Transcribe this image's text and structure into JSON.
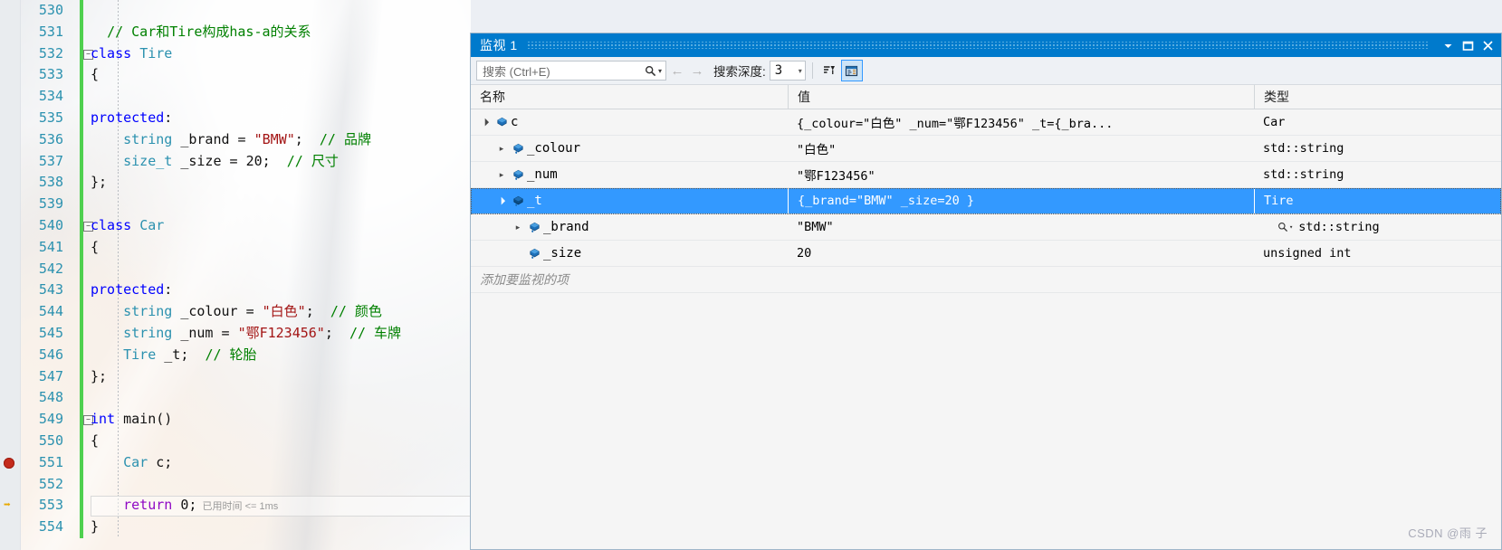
{
  "editor": {
    "lines": [
      {
        "num": "530",
        "tokens": [],
        "fold": false,
        "marker": ""
      },
      {
        "num": "531",
        "tokens": [
          {
            "t": "  ",
            "c": "pln"
          },
          {
            "t": "// Car和Tire构成has-a的关系",
            "c": "cmt"
          }
        ],
        "fold": false,
        "marker": ""
      },
      {
        "num": "532",
        "tokens": [
          {
            "t": "class",
            "c": "kw"
          },
          {
            "t": " ",
            "c": "pln"
          },
          {
            "t": "Tire",
            "c": "typ"
          }
        ],
        "fold": true,
        "marker": ""
      },
      {
        "num": "533",
        "tokens": [
          {
            "t": "{",
            "c": "pln"
          }
        ],
        "fold": false,
        "marker": ""
      },
      {
        "num": "534",
        "tokens": [],
        "fold": false,
        "marker": ""
      },
      {
        "num": "535",
        "tokens": [
          {
            "t": "protected",
            "c": "kw"
          },
          {
            "t": ":",
            "c": "pln"
          }
        ],
        "fold": false,
        "marker": ""
      },
      {
        "num": "536",
        "tokens": [
          {
            "t": "    ",
            "c": "pln"
          },
          {
            "t": "string",
            "c": "typ"
          },
          {
            "t": " _brand = ",
            "c": "pln"
          },
          {
            "t": "\"BMW\"",
            "c": "str"
          },
          {
            "t": ";  ",
            "c": "pln"
          },
          {
            "t": "// 品牌",
            "c": "cmt"
          }
        ],
        "fold": false,
        "marker": ""
      },
      {
        "num": "537",
        "tokens": [
          {
            "t": "    ",
            "c": "pln"
          },
          {
            "t": "size_t",
            "c": "typ"
          },
          {
            "t": " _size = ",
            "c": "pln"
          },
          {
            "t": "20",
            "c": "num"
          },
          {
            "t": ";  ",
            "c": "pln"
          },
          {
            "t": "// 尺寸",
            "c": "cmt"
          }
        ],
        "fold": false,
        "marker": ""
      },
      {
        "num": "538",
        "tokens": [
          {
            "t": "};",
            "c": "pln"
          }
        ],
        "fold": false,
        "marker": ""
      },
      {
        "num": "539",
        "tokens": [],
        "fold": false,
        "marker": ""
      },
      {
        "num": "540",
        "tokens": [
          {
            "t": "class",
            "c": "kw"
          },
          {
            "t": " ",
            "c": "pln"
          },
          {
            "t": "Car",
            "c": "typ"
          }
        ],
        "fold": true,
        "marker": ""
      },
      {
        "num": "541",
        "tokens": [
          {
            "t": "{",
            "c": "pln"
          }
        ],
        "fold": false,
        "marker": ""
      },
      {
        "num": "542",
        "tokens": [],
        "fold": false,
        "marker": ""
      },
      {
        "num": "543",
        "tokens": [
          {
            "t": "protected",
            "c": "kw"
          },
          {
            "t": ":",
            "c": "pln"
          }
        ],
        "fold": false,
        "marker": ""
      },
      {
        "num": "544",
        "tokens": [
          {
            "t": "    ",
            "c": "pln"
          },
          {
            "t": "string",
            "c": "typ"
          },
          {
            "t": " _colour = ",
            "c": "pln"
          },
          {
            "t": "\"白色\"",
            "c": "str"
          },
          {
            "t": ";  ",
            "c": "pln"
          },
          {
            "t": "// 颜色",
            "c": "cmt"
          }
        ],
        "fold": false,
        "marker": ""
      },
      {
        "num": "545",
        "tokens": [
          {
            "t": "    ",
            "c": "pln"
          },
          {
            "t": "string",
            "c": "typ"
          },
          {
            "t": " _num = ",
            "c": "pln"
          },
          {
            "t": "\"鄂F123456\"",
            "c": "str"
          },
          {
            "t": ";  ",
            "c": "pln"
          },
          {
            "t": "// 车牌",
            "c": "cmt"
          }
        ],
        "fold": false,
        "marker": ""
      },
      {
        "num": "546",
        "tokens": [
          {
            "t": "    ",
            "c": "pln"
          },
          {
            "t": "Tire",
            "c": "typ"
          },
          {
            "t": " _t;  ",
            "c": "pln"
          },
          {
            "t": "// 轮胎",
            "c": "cmt"
          }
        ],
        "fold": false,
        "marker": ""
      },
      {
        "num": "547",
        "tokens": [
          {
            "t": "};",
            "c": "pln"
          }
        ],
        "fold": false,
        "marker": ""
      },
      {
        "num": "548",
        "tokens": [],
        "fold": false,
        "marker": ""
      },
      {
        "num": "549",
        "tokens": [
          {
            "t": "int",
            "c": "kw"
          },
          {
            "t": " ",
            "c": "pln"
          },
          {
            "t": "main",
            "c": "pln"
          },
          {
            "t": "()",
            "c": "pln"
          }
        ],
        "fold": true,
        "marker": ""
      },
      {
        "num": "550",
        "tokens": [
          {
            "t": "{",
            "c": "pln"
          }
        ],
        "fold": false,
        "marker": ""
      },
      {
        "num": "551",
        "tokens": [
          {
            "t": "    ",
            "c": "pln"
          },
          {
            "t": "Car",
            "c": "typ"
          },
          {
            "t": " c;",
            "c": "pln"
          }
        ],
        "fold": false,
        "marker": "breakpoint"
      },
      {
        "num": "552",
        "tokens": [],
        "fold": false,
        "marker": ""
      },
      {
        "num": "553",
        "tokens": [
          {
            "t": "    ",
            "c": "pln"
          },
          {
            "t": "return",
            "c": "ctl"
          },
          {
            "t": " ",
            "c": "pln"
          },
          {
            "t": "0",
            "c": "num"
          },
          {
            "t": ";",
            "c": "pln"
          }
        ],
        "fold": false,
        "marker": "current",
        "elapsed": "已用时间 <= 1ms",
        "executing": true
      },
      {
        "num": "554",
        "tokens": [
          {
            "t": "}",
            "c": "pln"
          }
        ],
        "fold": false,
        "marker": ""
      }
    ]
  },
  "watch": {
    "title": "监视 1",
    "titlebar_buttons": [
      {
        "name": "window-menu-chevron",
        "glyph": "▼"
      },
      {
        "name": "maximize-window",
        "glyph": "❐"
      },
      {
        "name": "close-window",
        "glyph": "✕"
      }
    ],
    "toolbar": {
      "search_placeholder": "搜索 (Ctrl+E)",
      "search_value": "",
      "search_icon": "search-icon",
      "search_dropdown_caret": "▾",
      "prev_label": "←",
      "next_label": "→",
      "depth_label": "搜索深度:",
      "depth_value": "3",
      "depth_caret": "▾",
      "button1_name": "filter-toolbar-button",
      "button2_name": "show-raw-values-toolbar-button",
      "button2_selected": true
    },
    "columns": [
      {
        "key": "name",
        "label": "名称"
      },
      {
        "key": "value",
        "label": "值"
      },
      {
        "key": "type",
        "label": "类型"
      }
    ],
    "rows": [
      {
        "name": "c",
        "value": "{_colour=\"白色\" _num=\"鄂F123456\" _t={_bra...",
        "type": "Car",
        "indent": 0,
        "expander": "open",
        "icon": "object-variable-icon",
        "selected": false,
        "magnifier": false
      },
      {
        "name": "_colour",
        "value": "\"白色\"",
        "type": "std::string",
        "indent": 1,
        "expander": "closed",
        "icon": "field-variable-icon",
        "selected": false,
        "magnifier": false
      },
      {
        "name": "_num",
        "value": "\"鄂F123456\"",
        "type": "std::string",
        "indent": 1,
        "expander": "closed",
        "icon": "field-variable-icon",
        "selected": false,
        "magnifier": false
      },
      {
        "name": "_t",
        "value": "{_brand=\"BMW\" _size=20 }",
        "type": "Tire",
        "indent": 1,
        "expander": "open",
        "icon": "field-variable-icon",
        "selected": true,
        "magnifier": false
      },
      {
        "name": "_brand",
        "value": "\"BMW\"",
        "type": "std::string",
        "indent": 2,
        "expander": "closed",
        "icon": "field-variable-icon",
        "selected": false,
        "magnifier": true
      },
      {
        "name": "_size",
        "value": "20",
        "type": "unsigned int",
        "indent": 2,
        "expander": "none",
        "icon": "field-variable-icon",
        "selected": false,
        "magnifier": false
      }
    ],
    "add_item_placeholder": "添加要监视的项"
  },
  "watermark": "CSDN @雨 子",
  "colors": {
    "accent": "#007acc",
    "selection": "#3399ff",
    "keyword": "#0000ff",
    "type": "#2b91af",
    "string": "#a31515",
    "comment": "#008000",
    "control": "#8f08c4",
    "changebar": "#4fd04f",
    "breakpoint": "#c42b1c"
  }
}
